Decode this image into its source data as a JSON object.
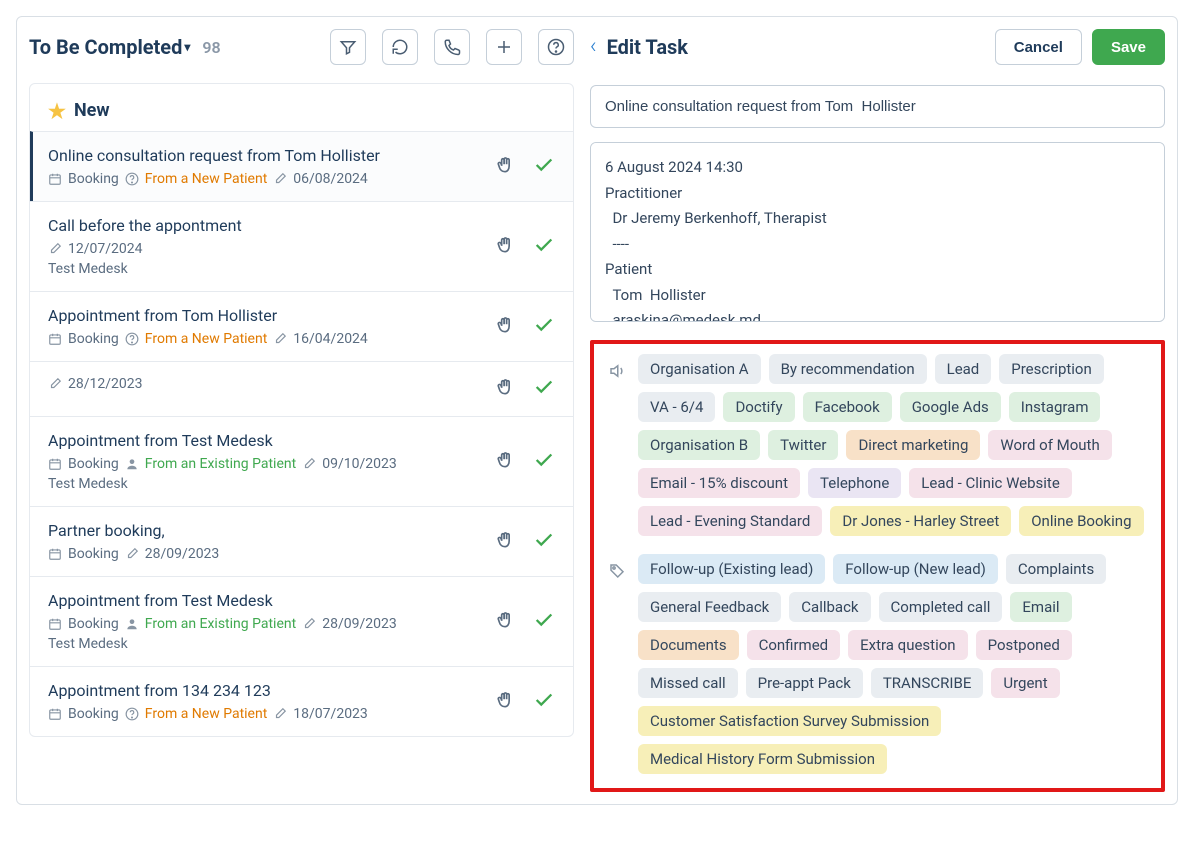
{
  "left": {
    "title": "To Be Completed",
    "count": "98",
    "section_title": "New"
  },
  "tasks": [
    {
      "title": "Online consultation request from Tom Hollister",
      "type": "Booking",
      "patient_label": "From a New Patient",
      "patient_kind": "new",
      "date": "06/08/2024",
      "subtitle": "",
      "selected": true,
      "show_type": true,
      "show_help": true
    },
    {
      "title": "Call before the appontment",
      "type": "",
      "patient_label": "",
      "patient_kind": "",
      "date": "12/07/2024",
      "subtitle": "Test Medesk",
      "selected": false,
      "show_type": false,
      "show_help": false
    },
    {
      "title": "Appointment from Tom Hollister",
      "type": "Booking",
      "patient_label": "From a New Patient",
      "patient_kind": "new",
      "date": "16/04/2024",
      "subtitle": "",
      "selected": false,
      "show_type": true,
      "show_help": true
    },
    {
      "title": "",
      "type": "",
      "patient_label": "",
      "patient_kind": "",
      "date": "28/12/2023",
      "subtitle": "",
      "selected": false,
      "show_type": false,
      "show_help": false
    },
    {
      "title": "Appointment from Test Medesk",
      "type": "Booking",
      "patient_label": "From an Existing Patient",
      "patient_kind": "existing",
      "date": "09/10/2023",
      "subtitle": "Test Medesk",
      "selected": false,
      "show_type": true,
      "show_help": false,
      "show_person": true
    },
    {
      "title": "Partner booking,",
      "type": "Booking",
      "patient_label": "",
      "patient_kind": "",
      "date": "28/09/2023",
      "subtitle": "",
      "selected": false,
      "show_type": true,
      "show_help": false
    },
    {
      "title": "Appointment from Test Medesk",
      "type": "Booking",
      "patient_label": "From an Existing Patient",
      "patient_kind": "existing",
      "date": "28/09/2023",
      "subtitle": "Test Medesk",
      "selected": false,
      "show_type": true,
      "show_help": false,
      "show_person": true
    },
    {
      "title": "Appointment from 134 234 123",
      "type": "Booking",
      "patient_label": "From a New Patient",
      "patient_kind": "new",
      "date": "18/07/2023",
      "subtitle": "",
      "selected": false,
      "show_type": true,
      "show_help": true
    }
  ],
  "right": {
    "title": "Edit Task",
    "cancel": "Cancel",
    "save": "Save",
    "task_name": "Online consultation request from Tom  Hollister",
    "detail": "6 August 2024 14:30\nPractitioner\n  Dr Jeremy Berkenhoff, Therapist\n  ----\nPatient\n  Tom  Hollister\n  araskina@medesk.md"
  },
  "tags1": [
    {
      "label": "Organisation A",
      "cls": "c-gray"
    },
    {
      "label": "By recommendation",
      "cls": "c-gray"
    },
    {
      "label": "Lead",
      "cls": "c-gray"
    },
    {
      "label": "Prescription",
      "cls": "c-gray"
    },
    {
      "label": "VA - 6/4",
      "cls": "c-gray"
    },
    {
      "label": "Doctify",
      "cls": "c-green"
    },
    {
      "label": "Facebook",
      "cls": "c-green"
    },
    {
      "label": "Google Ads",
      "cls": "c-green"
    },
    {
      "label": "Instagram",
      "cls": "c-green"
    },
    {
      "label": "Organisation B",
      "cls": "c-green"
    },
    {
      "label": "Twitter",
      "cls": "c-green"
    },
    {
      "label": "Direct marketing",
      "cls": "c-orange"
    },
    {
      "label": "Word of Mouth",
      "cls": "c-pink"
    },
    {
      "label": "Email - 15% discount",
      "cls": "c-pink"
    },
    {
      "label": "Telephone",
      "cls": "c-purple"
    },
    {
      "label": "Lead - Clinic Website",
      "cls": "c-pink"
    },
    {
      "label": "Lead - Evening Standard",
      "cls": "c-pink"
    },
    {
      "label": "Dr Jones - Harley Street",
      "cls": "c-yellow"
    },
    {
      "label": "Online Booking",
      "cls": "c-yellow"
    }
  ],
  "tags2": [
    {
      "label": "Follow-up (Existing lead)",
      "cls": "c-blue"
    },
    {
      "label": "Follow-up (New lead)",
      "cls": "c-blue"
    },
    {
      "label": "Complaints",
      "cls": "c-gray"
    },
    {
      "label": "General Feedback",
      "cls": "c-gray"
    },
    {
      "label": "Callback",
      "cls": "c-gray"
    },
    {
      "label": "Completed call",
      "cls": "c-gray"
    },
    {
      "label": "Email",
      "cls": "c-green"
    },
    {
      "label": "Documents",
      "cls": "c-orange"
    },
    {
      "label": "Confirmed",
      "cls": "c-pink"
    },
    {
      "label": "Extra question",
      "cls": "c-pink"
    },
    {
      "label": "Postponed",
      "cls": "c-pink"
    },
    {
      "label": "Missed call",
      "cls": "c-gray"
    },
    {
      "label": "Pre-appt Pack",
      "cls": "c-gray"
    },
    {
      "label": "TRANSCRIBE",
      "cls": "c-gray"
    },
    {
      "label": "Urgent",
      "cls": "c-pink"
    },
    {
      "label": "Customer Satisfaction Survey Submission",
      "cls": "c-yellow"
    },
    {
      "label": "Medical History Form Submission",
      "cls": "c-yellow"
    }
  ]
}
